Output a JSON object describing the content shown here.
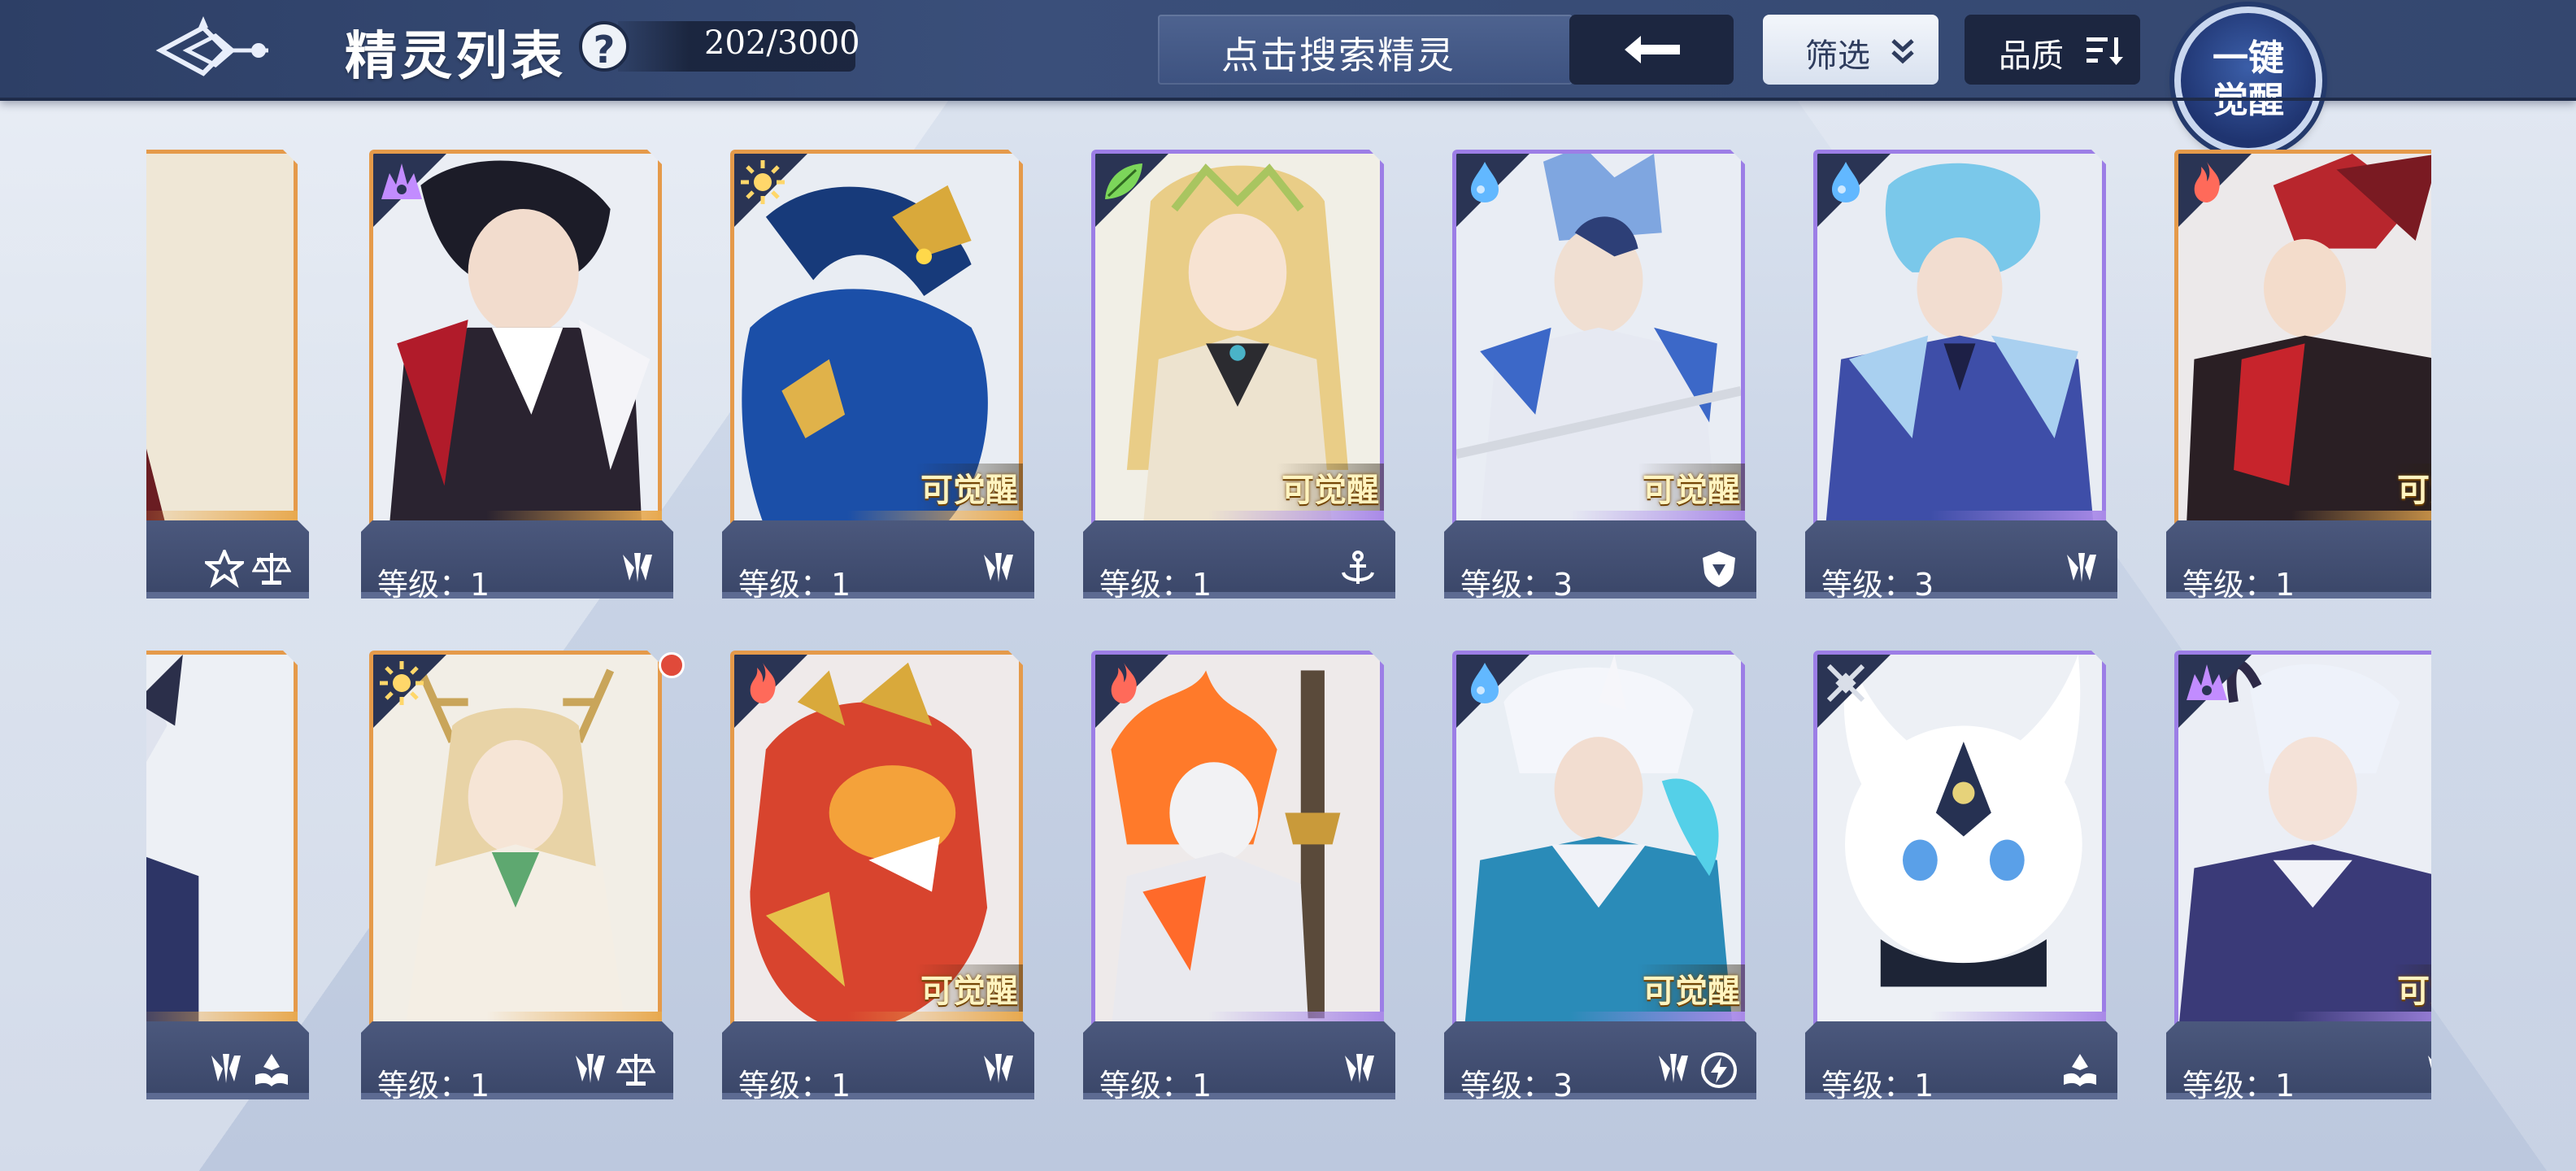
{
  "header": {
    "title": "精灵列表",
    "help_label": "?",
    "count": "202/3000",
    "search_placeholder": "点击搜索精灵",
    "filter_label": "筛选",
    "quality_label": "品质",
    "awaken_line1": "一键",
    "awaken_line2": "觉醒"
  },
  "colors": {
    "orange_frame": "#e59a4a",
    "purple_frame": "#9c7ee6",
    "plate": "#3a4668",
    "topbar": "#34476f"
  },
  "cards": [
    {
      "level": "",
      "element": "none",
      "frame": "orange",
      "awaken": "",
      "type_icons": [
        "star-shield-icon",
        "balance-icon"
      ],
      "art": "golden-horned-hero"
    },
    {
      "level": "等级：1",
      "element": "dark-icon",
      "frame": "orange",
      "awaken": "",
      "type_icons": [
        "claw-icon"
      ],
      "art": "vampire-lord"
    },
    {
      "level": "等级：1",
      "element": "light-icon",
      "frame": "orange",
      "awaken": "可觉醒",
      "type_icons": [
        "claw-icon"
      ],
      "art": "blue-dragon"
    },
    {
      "level": "等级：1",
      "element": "leaf-icon",
      "frame": "purple",
      "awaken": "可觉醒",
      "type_icons": [
        "anchor-icon"
      ],
      "art": "forest-elf"
    },
    {
      "level": "等级：3",
      "element": "water-icon",
      "frame": "purple",
      "awaken": "可觉醒",
      "type_icons": [
        "shield-icon"
      ],
      "art": "ice-knight"
    },
    {
      "level": "等级：3",
      "element": "water-icon",
      "frame": "purple",
      "awaken": "",
      "type_icons": [
        "claw-icon"
      ],
      "art": "blue-warrior"
    },
    {
      "level": "等级：1",
      "element": "fire-icon",
      "frame": "orange",
      "awaken": "可觉",
      "type_icons": [],
      "art": "red-dragon-knight"
    },
    {
      "level": "",
      "element": "none",
      "frame": "orange",
      "awaken": "",
      "type_icons": [
        "claw-icon",
        "book-icon"
      ],
      "art": "white-haired-knight"
    },
    {
      "level": "等级：1",
      "element": "light-icon",
      "frame": "orange",
      "awaken": "",
      "type_icons": [
        "claw-icon",
        "balance-icon"
      ],
      "art": "antler-goddess"
    },
    {
      "level": "等级：1",
      "element": "fire-icon",
      "frame": "orange",
      "awaken": "可觉醒",
      "type_icons": [
        "claw-icon"
      ],
      "art": "fire-wolf"
    },
    {
      "level": "等级：1",
      "element": "fire-icon",
      "frame": "purple",
      "awaken": "",
      "type_icons": [
        "claw-icon"
      ],
      "art": "flame-swordsman"
    },
    {
      "level": "等级：3",
      "element": "water-icon",
      "frame": "purple",
      "awaken": "可觉醒",
      "type_icons": [
        "claw-icon",
        "lightning-icon"
      ],
      "art": "ice-mage"
    },
    {
      "level": "等级：1",
      "element": "neutral-icon",
      "frame": "purple",
      "awaken": "",
      "type_icons": [
        "book-icon"
      ],
      "art": "white-spirit"
    },
    {
      "level": "等级：1",
      "element": "dark-icon",
      "frame": "purple",
      "awaken": "可觉",
      "type_icons": [
        "claw-icon"
      ],
      "art": "demon-noble"
    }
  ]
}
